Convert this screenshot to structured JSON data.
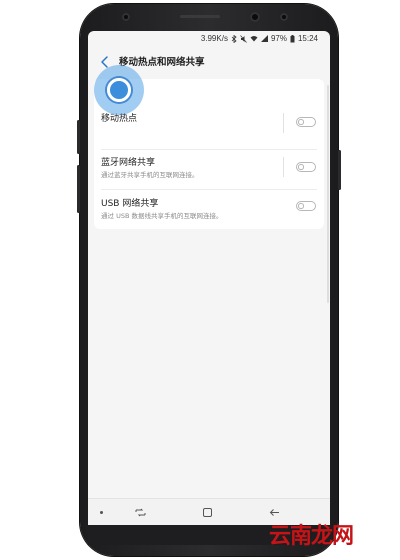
{
  "status_bar": {
    "net_speed": "3.99K/s",
    "battery": "97%",
    "time": "15:24"
  },
  "header": {
    "title": "移动热点和网络共享"
  },
  "settings": [
    {
      "title": "移动热点",
      "subtitle": "",
      "enabled": false
    },
    {
      "title": "蓝牙网络共享",
      "subtitle": "通过蓝牙共享手机的互联网连接。",
      "enabled": false
    },
    {
      "title": "USB 网络共享",
      "subtitle": "通过 USB 数据线共享手机的互联网连接。",
      "enabled": false
    }
  ],
  "watermark": "云南龙网",
  "colors": {
    "touch_highlight": "#3a8fd8",
    "watermark": "#c51418",
    "back_arrow": "#2c76c9"
  },
  "icons": [
    "chevron-left-icon",
    "bluetooth-icon",
    "signal-icon",
    "battery-icon",
    "recent-apps-icon",
    "home-icon",
    "back-icon"
  ]
}
